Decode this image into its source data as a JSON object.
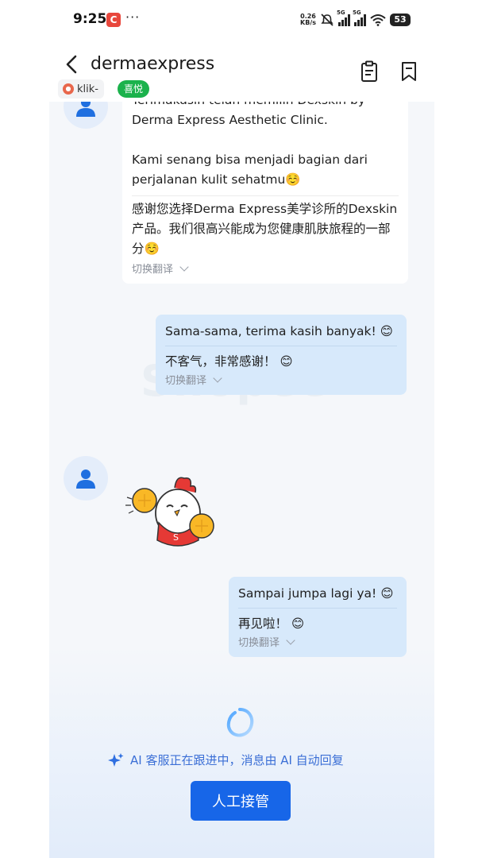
{
  "status_bar": {
    "time": "9:25",
    "app_badge": "C",
    "more": "···",
    "net_speed_value": "0.26",
    "net_speed_unit": "KB/s",
    "signal_1": "5G",
    "signal_2": "5G",
    "battery": "53"
  },
  "header": {
    "title": "dermaexpress",
    "shop_tag": "klik-",
    "mood_tag": "喜悦"
  },
  "chat": {
    "watermark": "Shopee",
    "messages": [
      {
        "from": "shop",
        "original": "Terimakasih telah memilih Dexskin by Derma Express Aesthetic Clinic.\n\nKami senang bisa menjadi bagian dari perjalanan kulit sehatmu☺️",
        "translation": "感谢您选择Derma Express美学诊所的Dexskin产品。我们很高兴能成为您健康肌肤旅程的一部分☺️",
        "toggle_label": "切换翻译"
      },
      {
        "from": "me",
        "original": "Sama-sama, terima kasih banyak! 😊",
        "translation": "不客气，非常感谢！ 😊",
        "toggle_label": "切换翻译"
      },
      {
        "from": "shop",
        "sticker": "chicken-cheering-sticker"
      },
      {
        "from": "me",
        "original": "Sampai jumpa lagi ya! 😊",
        "translation": "再见啦！ 😊",
        "toggle_label": "切换翻译"
      }
    ]
  },
  "ai": {
    "status_text": "AI 客服正在跟进中，消息由 AI 自动回复",
    "takeover_label": "人工接管"
  },
  "colors": {
    "accent": "#1766e8",
    "outgoing_bubble": "#d7e9fb",
    "mood_tag": "#1bb24c",
    "chat_bg": "#f5f7fa"
  },
  "icons": [
    "back-icon",
    "clipboard-icon",
    "bookmark-icon",
    "user-avatar-icon",
    "sparkle-icon",
    "spinner-icon"
  ]
}
